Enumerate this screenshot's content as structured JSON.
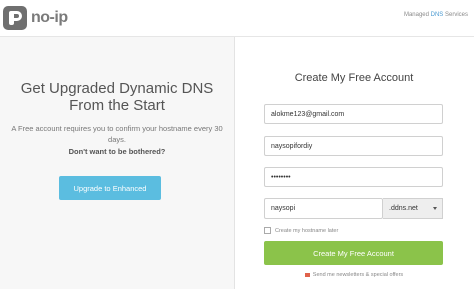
{
  "header": {
    "logo_text": "no-ip",
    "tagline_prefix": "Managed ",
    "tagline_highlight": "DNS",
    "tagline_suffix": " Services"
  },
  "left_panel": {
    "headline": "Get Upgraded Dynamic DNS From the Start",
    "description": "A Free account requires you to confirm your hostname every 30 days.",
    "callout": "Don't want to be bothered?",
    "upgrade_button": "Upgrade to Enhanced"
  },
  "form": {
    "title": "Create My Free Account",
    "email_value": "alokme123@gmail.com",
    "username_value": "naysopifordiy",
    "password_value": "••••••••",
    "hostname_value": "naysopi",
    "domain_selected": ".ddns.net",
    "later_checkbox_label": "Create my hostname later",
    "create_button": "Create My Free Account",
    "newsletter_label": "Send me newsletters & special offers"
  },
  "colors": {
    "accent_green": "#8bc34a",
    "accent_blue": "#5bbde0",
    "newsletter_red": "#e0624b"
  }
}
